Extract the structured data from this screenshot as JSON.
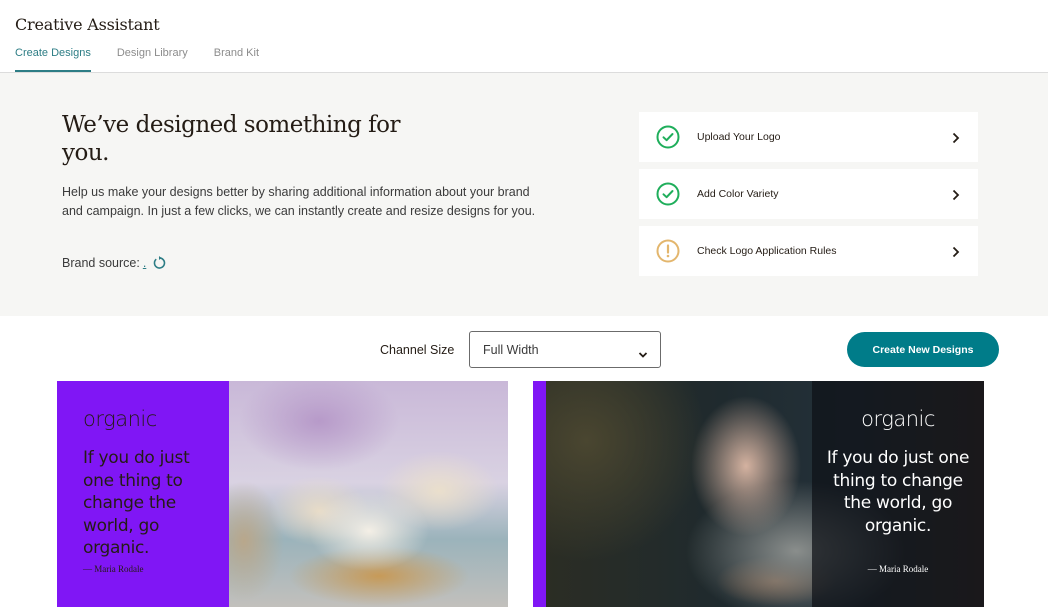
{
  "app": {
    "title": "Creative Assistant",
    "tabs": [
      {
        "label": "Create Designs",
        "active": true
      },
      {
        "label": "Design Library",
        "active": false
      },
      {
        "label": "Brand Kit",
        "active": false
      }
    ]
  },
  "hero": {
    "title": "We’ve designed something for you.",
    "description": "Help us make your designs better by sharing additional information about your brand and campaign. In just a few clicks, we can instantly create and resize designs for you.",
    "brand_source_label": "Brand source:",
    "brand_source_link": ".",
    "refresh_icon": "refresh-icon"
  },
  "checklist": [
    {
      "label": "Upload Your Logo",
      "status": "complete",
      "icon": "check-circle-icon",
      "color": "#1fae5b"
    },
    {
      "label": "Add Color Variety",
      "status": "complete",
      "icon": "check-circle-icon",
      "color": "#1fae5b"
    },
    {
      "label": "Check Logo Application Rules",
      "status": "warning",
      "icon": "exclamation-circle-icon",
      "color": "#e3b66d"
    }
  ],
  "controls": {
    "channel_size_label": "Channel Size",
    "channel_size_value": "Full Width",
    "create_button": "Create New Designs"
  },
  "designs": [
    {
      "brand": "organic",
      "quote": "If you do just one thing to change the world, go organic.",
      "author": "— Maria Rodale",
      "image": "soap bars on wooden plate",
      "layout": "purple panel left, photo right"
    },
    {
      "brand": "organic",
      "quote": "If you do just one thing to change the world, go organic.",
      "author": "— Maria Rodale",
      "image": "hand with mortar and pestle",
      "layout": "purple strip left, dark overlay right"
    }
  ],
  "colors": {
    "accent_teal": "#007c89",
    "tab_active": "#2d7d85",
    "brand_purple": "#8016f5",
    "success_green": "#1fae5b",
    "warning_gold": "#e3b66d"
  }
}
